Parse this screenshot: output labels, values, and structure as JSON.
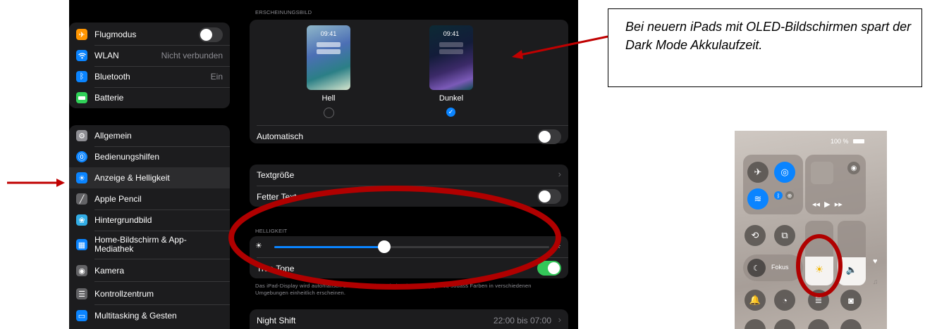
{
  "sidebar": {
    "group1": [
      {
        "label": "Flugmodus",
        "value": "",
        "icon": "airplane-icon",
        "color": "#ff9500",
        "toggle": "off"
      },
      {
        "label": "WLAN",
        "value": "Nicht verbunden",
        "icon": "wifi-icon",
        "color": "#0a84ff"
      },
      {
        "label": "Bluetooth",
        "value": "Ein",
        "icon": "bluetooth-icon",
        "color": "#0a84ff"
      },
      {
        "label": "Batterie",
        "value": "",
        "icon": "battery-icon",
        "color": "#30d158"
      }
    ],
    "group2": [
      {
        "label": "Allgemein",
        "icon": "gear-icon",
        "color": "#8e8e93"
      },
      {
        "label": "Bedienungshilfen",
        "icon": "accessibility-icon",
        "color": "#0a84ff"
      },
      {
        "label": "Anzeige & Helligkeit",
        "icon": "sun-icon",
        "color": "#0a84ff"
      },
      {
        "label": "Apple Pencil",
        "icon": "pencil-icon",
        "color": "#636366"
      },
      {
        "label": "Hintergrundbild",
        "icon": "flower-icon",
        "color": "#32ade6"
      },
      {
        "label": "Home-Bildschirm & App-Mediathek",
        "icon": "home-screen-icon",
        "color": "#0a84ff"
      },
      {
        "label": "Kamera",
        "icon": "camera-icon",
        "color": "#636366"
      },
      {
        "label": "Kontrollzentrum",
        "icon": "switches-icon",
        "color": "#636366"
      },
      {
        "label": "Multitasking & Gesten",
        "icon": "multitasking-icon",
        "color": "#0a84ff"
      }
    ]
  },
  "appearance": {
    "section_header": "ERSCHEINUNGSBILD",
    "preview_time": "09:41",
    "light_label": "Hell",
    "dark_label": "Dunkel",
    "selected": "Dunkel",
    "auto_label": "Automatisch"
  },
  "text": {
    "size_label": "Textgröße",
    "bold_label": "Fetter Text"
  },
  "brightness": {
    "section_header": "HELLIGKEIT",
    "level": 0.4,
    "true_tone_label": "True Tone",
    "footnote": "Das iPad-Display wird automatisch an die Umgebungsbeleuchtung angepasst, sodass Farben in verschiedenen Umgebungen einheitlich erscheinen."
  },
  "night_shift": {
    "label": "Night Shift",
    "value": "22:00 bis 07:00"
  },
  "callout": {
    "text": "Bei neuern iPads mit OLED-Bildschirmen spart der Dark Mode Akkulaufzeit."
  },
  "control_center": {
    "battery": "100 %",
    "focus_label": "Fokus",
    "brightness_level": 0.45
  },
  "colors": {
    "annotation_red": "#c00000",
    "accent_blue": "#0a84ff",
    "switch_green": "#34c759"
  }
}
